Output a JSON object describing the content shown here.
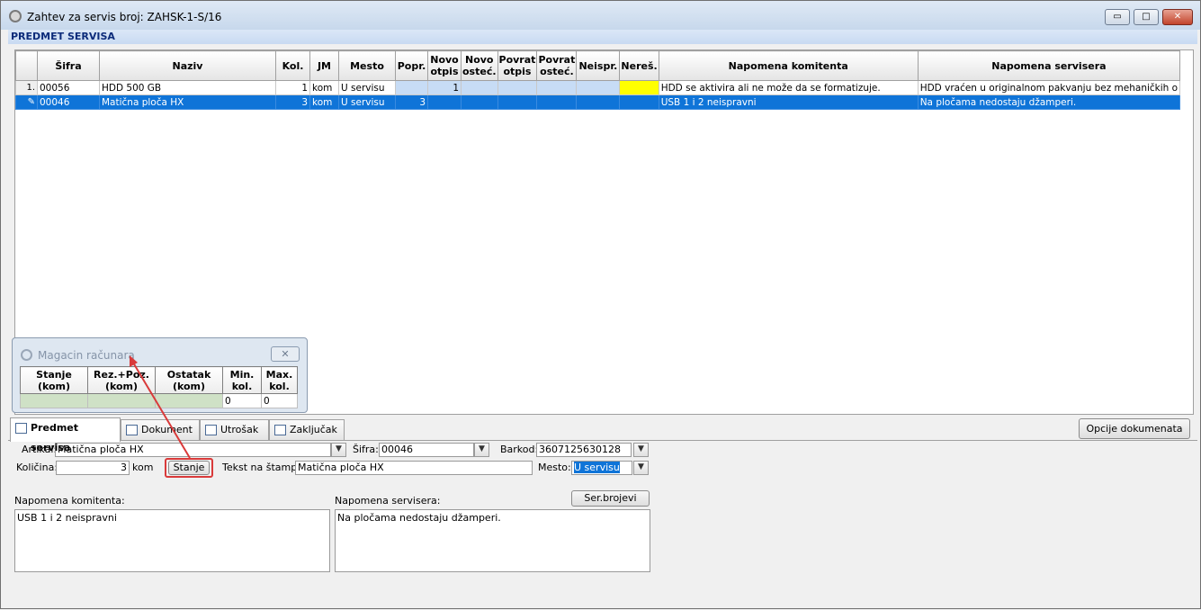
{
  "window": {
    "title": "Zahtev za servis broj: ZAHSK-1-S/16",
    "buttons": {
      "minimize": "▭",
      "maximize": "□",
      "close": "✕"
    }
  },
  "section": {
    "title": "PREDMET SERVISA"
  },
  "grid": {
    "columns": [
      "Šifra",
      "Naziv",
      "Kol.",
      "JM",
      "Mesto",
      "Popr.",
      "Novo otpis",
      "Novo osteć.",
      "Povrat otpis",
      "Povrat osteć.",
      "Neispr.",
      "Nereš.",
      "Napomena komitenta",
      "Napomena servisera"
    ],
    "rows": [
      {
        "num": "1.",
        "sifra": "00056",
        "naziv": "HDD 500 GB",
        "kol": "1",
        "jm": "kom",
        "mesto": "U servisu",
        "popr": "",
        "novo_otpis": "1",
        "novo_ostec": "",
        "povrat_otpis": "",
        "povrat_ostec": "",
        "neispr": "",
        "neres": "",
        "nap_kom": "HDD se aktivira ali ne može da se formatizuje.",
        "nap_serv": "HDD vraćen u originalnom pakvanju bez mehaničkih o"
      },
      {
        "num": "",
        "sifra": "00046",
        "naziv": "Matična ploča HX",
        "kol": "3",
        "jm": "kom",
        "mesto": "U servisu",
        "popr": "3",
        "novo_otpis": "",
        "novo_ostec": "",
        "povrat_otpis": "",
        "povrat_ostec": "",
        "neispr": "",
        "neres": "",
        "nap_kom": "USB 1 i 2 neispravni",
        "nap_serv": "Na pločama nedostaju džamperi."
      }
    ]
  },
  "magacin": {
    "title": "Magacin računara",
    "close": "✕",
    "columns": [
      "Stanje (kom)",
      "Rez.+Poz. (kom)",
      "Ostatak (kom)",
      "Min. kol.",
      "Max. kol."
    ],
    "row": [
      "",
      "",
      "",
      "0",
      "0"
    ]
  },
  "tabs": [
    "Predmet servisa",
    "Dokument",
    "Utrošak",
    "Zaključak"
  ],
  "opcije_button": "Opcije dokumenata",
  "form": {
    "artikal_label": "Artikal:",
    "artikal_value": "Matična ploča HX",
    "sifra_label": "Šifra:",
    "sifra_value": "00046",
    "barkod_label": "Barkod:",
    "barkod_value": "3607125630128",
    "kolicina_label": "Količina:",
    "kolicina_value": "3",
    "kolicina_unit": "kom",
    "stanje_button": "Stanje",
    "tekst_label": "Tekst na štampi:",
    "tekst_value": "Matična ploča HX",
    "mesto_label": "Mesto:",
    "mesto_value": "U servisu",
    "ser_brojevi_button": "Ser.brojevi",
    "nap_kom_label": "Napomena komitenta:",
    "nap_kom_value": "USB 1 i 2 neispravni",
    "nap_serv_label": "Napomena servisera:",
    "nap_serv_value": "Na pločama nedostaju džamperi."
  },
  "colors": {
    "selection": "#0f74d8",
    "highlight": "#ffff00",
    "annotation": "#d93a3a"
  }
}
